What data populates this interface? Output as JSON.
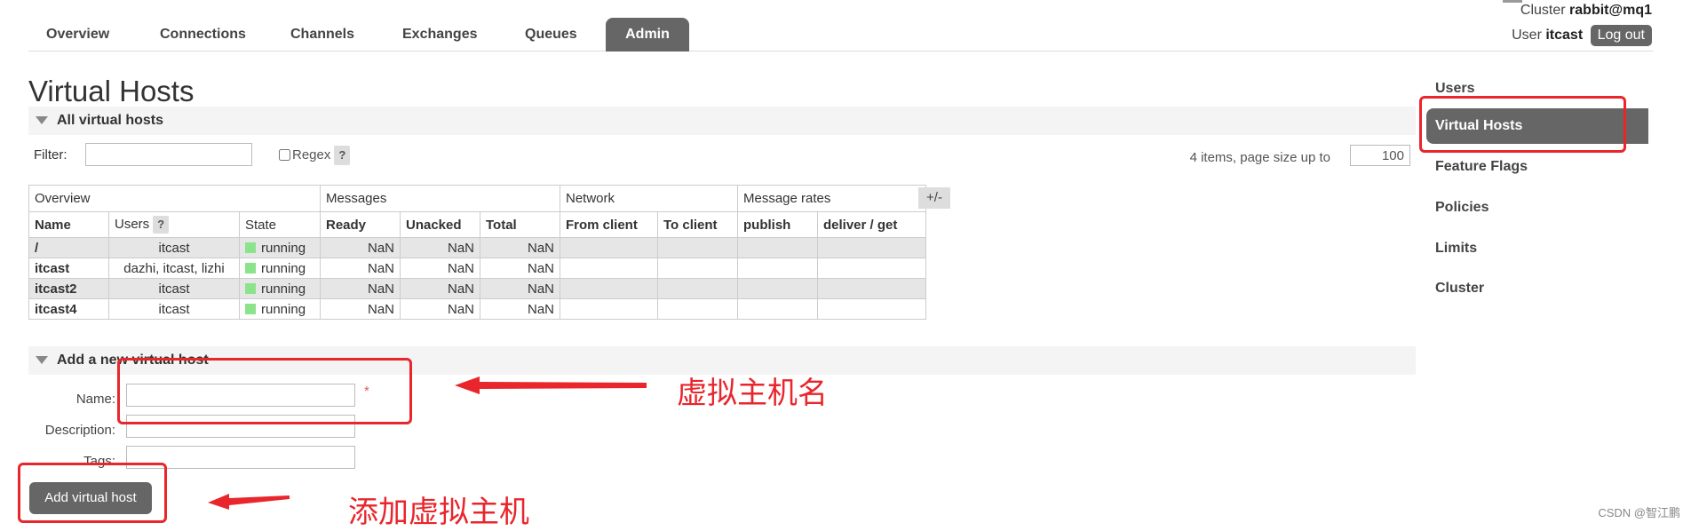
{
  "nav": {
    "tabs": [
      {
        "label": "Overview"
      },
      {
        "label": "Connections"
      },
      {
        "label": "Channels"
      },
      {
        "label": "Exchanges"
      },
      {
        "label": "Queues"
      },
      {
        "label": "Admin"
      }
    ],
    "active_tab": "Admin"
  },
  "header": {
    "cluster_label": "Cluster",
    "cluster_name": "rabbit@mq1",
    "user_label": "User",
    "user_name": "itcast",
    "logout_label": "Log out"
  },
  "page": {
    "title": "Virtual Hosts"
  },
  "all_vhosts": {
    "section_title": "All virtual hosts",
    "filter_label": "Filter:",
    "filter_value": "",
    "regex_label": "Regex",
    "help_label": "?",
    "paging_text": "4 items, page size up to",
    "page_size": "100",
    "plus_minus": "+/-",
    "group_headers": [
      "Overview",
      "Messages",
      "Network",
      "Message rates"
    ],
    "columns": [
      "Name",
      "Users",
      "State",
      "Ready",
      "Unacked",
      "Total",
      "From client",
      "To client",
      "publish",
      "deliver / get"
    ],
    "rows": [
      {
        "name": "/",
        "users": "itcast",
        "state": "running",
        "ready": "NaN",
        "unacked": "NaN",
        "total": "NaN"
      },
      {
        "name": "itcast",
        "users": "dazhi, itcast, lizhi",
        "state": "running",
        "ready": "NaN",
        "unacked": "NaN",
        "total": "NaN"
      },
      {
        "name": "itcast2",
        "users": "itcast",
        "state": "running",
        "ready": "NaN",
        "unacked": "NaN",
        "total": "NaN"
      },
      {
        "name": "itcast4",
        "users": "itcast",
        "state": "running",
        "ready": "NaN",
        "unacked": "NaN",
        "total": "NaN"
      }
    ]
  },
  "add_vhost": {
    "section_title": "Add a new virtual host",
    "name_label": "Name:",
    "description_label": "Description:",
    "tags_label": "Tags:",
    "required_mark": "*",
    "submit_label": "Add virtual host"
  },
  "sidebar": {
    "items": [
      {
        "label": "Users"
      },
      {
        "label": "Virtual Hosts"
      },
      {
        "label": "Feature Flags"
      },
      {
        "label": "Policies"
      },
      {
        "label": "Limits"
      },
      {
        "label": "Cluster"
      }
    ],
    "active": "Virtual Hosts"
  },
  "annotations": {
    "vhost_name": "虚拟主机名",
    "add_vhost": "添加虚拟主机",
    "color": "#e8262c"
  },
  "watermark": "CSDN @智江鹏"
}
